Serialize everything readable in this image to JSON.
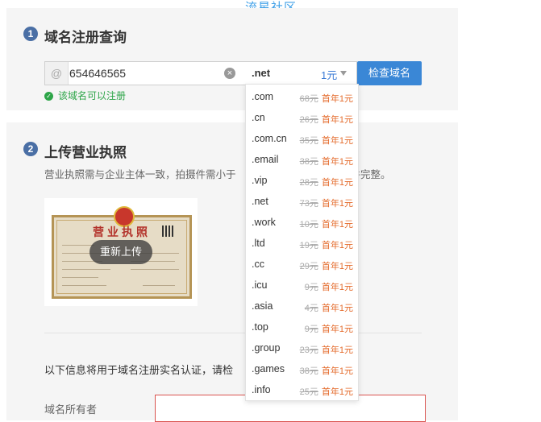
{
  "watermark": "流星社区",
  "step1": {
    "number": "1",
    "title": "域名注册查询"
  },
  "search": {
    "value": "654646565",
    "at_symbol": "@",
    "clear_symbol": "×",
    "suffix": ".net",
    "price": "1元",
    "query_label": "检查域名"
  },
  "status": {
    "check_symbol": "✓",
    "text": "该域名可以注册",
    "color": "#2da548"
  },
  "step2": {
    "number": "2",
    "title": "上传营业执照",
    "hint_left": "营业执照需与企业主体一致，拍摄件需小于",
    "hint_right": "件完整。"
  },
  "license": {
    "title": "营业执照",
    "reupload_label": "重新上传"
  },
  "form": {
    "info_text": "以下信息将用于域名注册实名认证，请检",
    "owner_label": "域名所有者",
    "owner_value": ""
  },
  "dropdown": {
    "items": [
      {
        "suffix": ".com",
        "orig": "68元",
        "first": "首年1元"
      },
      {
        "suffix": ".cn",
        "orig": "26元",
        "first": "首年1元"
      },
      {
        "suffix": ".com.cn",
        "orig": "35元",
        "first": "首年1元"
      },
      {
        "suffix": ".email",
        "orig": "38元",
        "first": "首年1元"
      },
      {
        "suffix": ".vip",
        "orig": "28元",
        "first": "首年1元"
      },
      {
        "suffix": ".net",
        "orig": "73元",
        "first": "首年1元"
      },
      {
        "suffix": ".work",
        "orig": "10元",
        "first": "首年1元"
      },
      {
        "suffix": ".ltd",
        "orig": "19元",
        "first": "首年1元"
      },
      {
        "suffix": ".cc",
        "orig": "29元",
        "first": "首年1元"
      },
      {
        "suffix": ".icu",
        "orig": "9元",
        "first": "首年1元"
      },
      {
        "suffix": ".asia",
        "orig": "4元",
        "first": "首年1元"
      },
      {
        "suffix": ".top",
        "orig": "9元",
        "first": "首年1元"
      },
      {
        "suffix": ".group",
        "orig": "23元",
        "first": "首年1元"
      },
      {
        "suffix": ".games",
        "orig": "38元",
        "first": "首年1元"
      },
      {
        "suffix": ".info",
        "orig": "25元",
        "first": "首年1元"
      }
    ]
  },
  "colors": {
    "accent": "#3a87d6",
    "price_link": "#3a7bd5",
    "first_year": "#e46a2a",
    "error_border": "#d9534f"
  }
}
